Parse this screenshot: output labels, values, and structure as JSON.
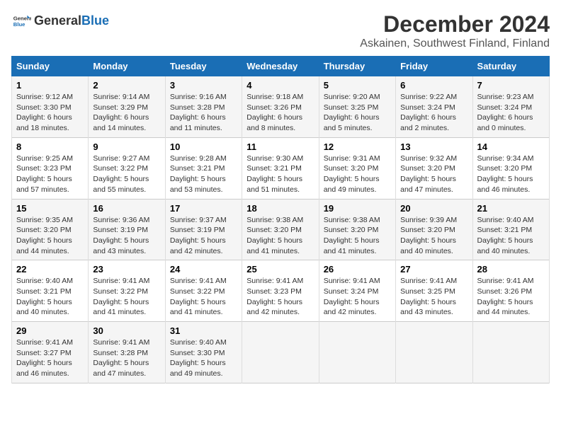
{
  "logo": {
    "text_general": "General",
    "text_blue": "Blue"
  },
  "title": "December 2024",
  "subtitle": "Askainen, Southwest Finland, Finland",
  "headers": [
    "Sunday",
    "Monday",
    "Tuesday",
    "Wednesday",
    "Thursday",
    "Friday",
    "Saturday"
  ],
  "weeks": [
    [
      {
        "day": "1",
        "sunrise": "Sunrise: 9:12 AM",
        "sunset": "Sunset: 3:30 PM",
        "daylight": "Daylight: 6 hours and 18 minutes."
      },
      {
        "day": "2",
        "sunrise": "Sunrise: 9:14 AM",
        "sunset": "Sunset: 3:29 PM",
        "daylight": "Daylight: 6 hours and 14 minutes."
      },
      {
        "day": "3",
        "sunrise": "Sunrise: 9:16 AM",
        "sunset": "Sunset: 3:28 PM",
        "daylight": "Daylight: 6 hours and 11 minutes."
      },
      {
        "day": "4",
        "sunrise": "Sunrise: 9:18 AM",
        "sunset": "Sunset: 3:26 PM",
        "daylight": "Daylight: 6 hours and 8 minutes."
      },
      {
        "day": "5",
        "sunrise": "Sunrise: 9:20 AM",
        "sunset": "Sunset: 3:25 PM",
        "daylight": "Daylight: 6 hours and 5 minutes."
      },
      {
        "day": "6",
        "sunrise": "Sunrise: 9:22 AM",
        "sunset": "Sunset: 3:24 PM",
        "daylight": "Daylight: 6 hours and 2 minutes."
      },
      {
        "day": "7",
        "sunrise": "Sunrise: 9:23 AM",
        "sunset": "Sunset: 3:24 PM",
        "daylight": "Daylight: 6 hours and 0 minutes."
      }
    ],
    [
      {
        "day": "8",
        "sunrise": "Sunrise: 9:25 AM",
        "sunset": "Sunset: 3:23 PM",
        "daylight": "Daylight: 5 hours and 57 minutes."
      },
      {
        "day": "9",
        "sunrise": "Sunrise: 9:27 AM",
        "sunset": "Sunset: 3:22 PM",
        "daylight": "Daylight: 5 hours and 55 minutes."
      },
      {
        "day": "10",
        "sunrise": "Sunrise: 9:28 AM",
        "sunset": "Sunset: 3:21 PM",
        "daylight": "Daylight: 5 hours and 53 minutes."
      },
      {
        "day": "11",
        "sunrise": "Sunrise: 9:30 AM",
        "sunset": "Sunset: 3:21 PM",
        "daylight": "Daylight: 5 hours and 51 minutes."
      },
      {
        "day": "12",
        "sunrise": "Sunrise: 9:31 AM",
        "sunset": "Sunset: 3:20 PM",
        "daylight": "Daylight: 5 hours and 49 minutes."
      },
      {
        "day": "13",
        "sunrise": "Sunrise: 9:32 AM",
        "sunset": "Sunset: 3:20 PM",
        "daylight": "Daylight: 5 hours and 47 minutes."
      },
      {
        "day": "14",
        "sunrise": "Sunrise: 9:34 AM",
        "sunset": "Sunset: 3:20 PM",
        "daylight": "Daylight: 5 hours and 46 minutes."
      }
    ],
    [
      {
        "day": "15",
        "sunrise": "Sunrise: 9:35 AM",
        "sunset": "Sunset: 3:20 PM",
        "daylight": "Daylight: 5 hours and 44 minutes."
      },
      {
        "day": "16",
        "sunrise": "Sunrise: 9:36 AM",
        "sunset": "Sunset: 3:19 PM",
        "daylight": "Daylight: 5 hours and 43 minutes."
      },
      {
        "day": "17",
        "sunrise": "Sunrise: 9:37 AM",
        "sunset": "Sunset: 3:19 PM",
        "daylight": "Daylight: 5 hours and 42 minutes."
      },
      {
        "day": "18",
        "sunrise": "Sunrise: 9:38 AM",
        "sunset": "Sunset: 3:20 PM",
        "daylight": "Daylight: 5 hours and 41 minutes."
      },
      {
        "day": "19",
        "sunrise": "Sunrise: 9:38 AM",
        "sunset": "Sunset: 3:20 PM",
        "daylight": "Daylight: 5 hours and 41 minutes."
      },
      {
        "day": "20",
        "sunrise": "Sunrise: 9:39 AM",
        "sunset": "Sunset: 3:20 PM",
        "daylight": "Daylight: 5 hours and 40 minutes."
      },
      {
        "day": "21",
        "sunrise": "Sunrise: 9:40 AM",
        "sunset": "Sunset: 3:21 PM",
        "daylight": "Daylight: 5 hours and 40 minutes."
      }
    ],
    [
      {
        "day": "22",
        "sunrise": "Sunrise: 9:40 AM",
        "sunset": "Sunset: 3:21 PM",
        "daylight": "Daylight: 5 hours and 40 minutes."
      },
      {
        "day": "23",
        "sunrise": "Sunrise: 9:41 AM",
        "sunset": "Sunset: 3:22 PM",
        "daylight": "Daylight: 5 hours and 41 minutes."
      },
      {
        "day": "24",
        "sunrise": "Sunrise: 9:41 AM",
        "sunset": "Sunset: 3:22 PM",
        "daylight": "Daylight: 5 hours and 41 minutes."
      },
      {
        "day": "25",
        "sunrise": "Sunrise: 9:41 AM",
        "sunset": "Sunset: 3:23 PM",
        "daylight": "Daylight: 5 hours and 42 minutes."
      },
      {
        "day": "26",
        "sunrise": "Sunrise: 9:41 AM",
        "sunset": "Sunset: 3:24 PM",
        "daylight": "Daylight: 5 hours and 42 minutes."
      },
      {
        "day": "27",
        "sunrise": "Sunrise: 9:41 AM",
        "sunset": "Sunset: 3:25 PM",
        "daylight": "Daylight: 5 hours and 43 minutes."
      },
      {
        "day": "28",
        "sunrise": "Sunrise: 9:41 AM",
        "sunset": "Sunset: 3:26 PM",
        "daylight": "Daylight: 5 hours and 44 minutes."
      }
    ],
    [
      {
        "day": "29",
        "sunrise": "Sunrise: 9:41 AM",
        "sunset": "Sunset: 3:27 PM",
        "daylight": "Daylight: 5 hours and 46 minutes."
      },
      {
        "day": "30",
        "sunrise": "Sunrise: 9:41 AM",
        "sunset": "Sunset: 3:28 PM",
        "daylight": "Daylight: 5 hours and 47 minutes."
      },
      {
        "day": "31",
        "sunrise": "Sunrise: 9:40 AM",
        "sunset": "Sunset: 3:30 PM",
        "daylight": "Daylight: 5 hours and 49 minutes."
      },
      null,
      null,
      null,
      null
    ]
  ]
}
